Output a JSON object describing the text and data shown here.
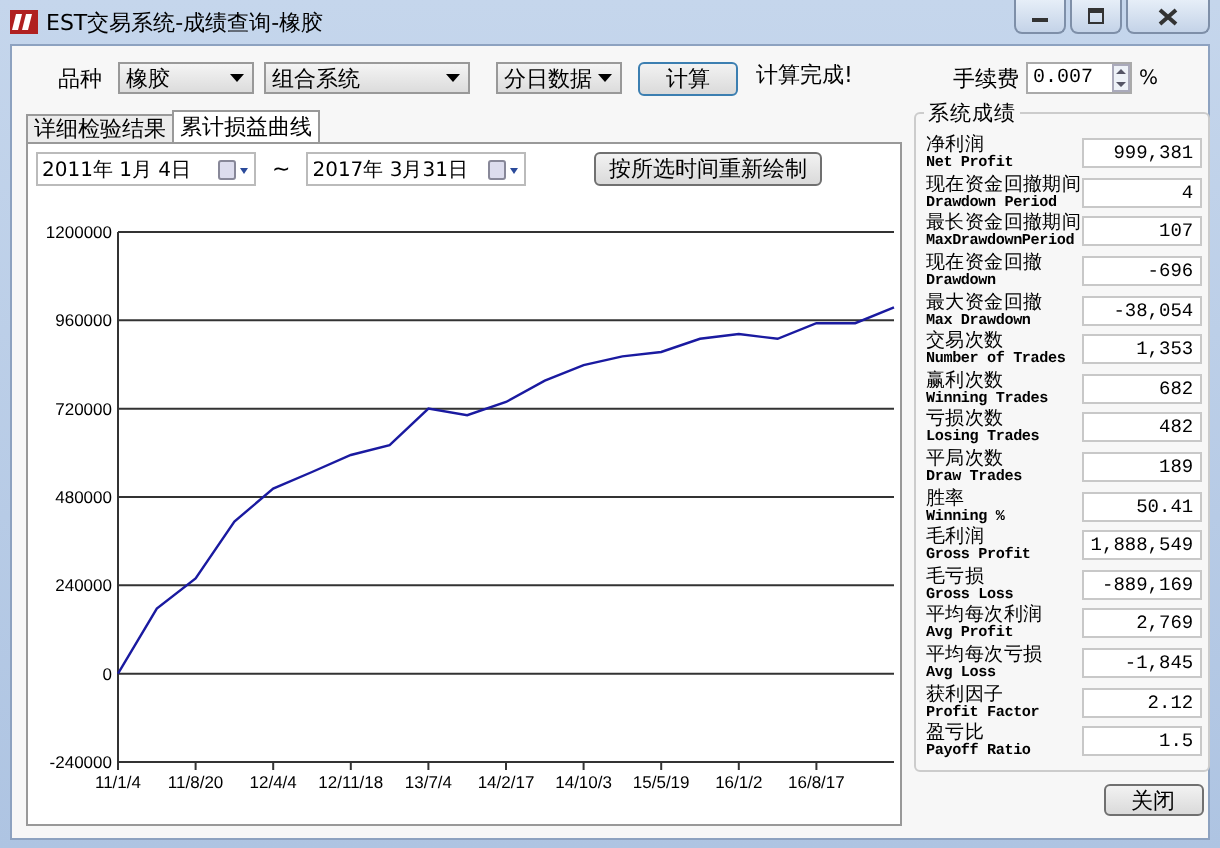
{
  "window": {
    "title": "EST交易系统-成绩查询-橡胶"
  },
  "toolbar": {
    "variety_label": "品种",
    "variety": "橡胶",
    "system": "组合系统",
    "data_mode": "分日数据",
    "calc_button": "计算",
    "status": "计算完成!",
    "fee_label": "手续费",
    "fee": "0.007",
    "fee_unit": "%"
  },
  "tabs": [
    {
      "label": "详细检验结果",
      "selected": false
    },
    {
      "label": "累计损益曲线",
      "selected": true
    }
  ],
  "range": {
    "start": "2011年 1月 4日",
    "separator": "~",
    "end": "2017年 3月31日",
    "redraw_button": "按所选时间重新绘制"
  },
  "chart": {
    "chart_data": {
      "type": "line",
      "categories": [
        "11/1/4",
        null,
        "11/8/20",
        null,
        "12/4/4",
        null,
        "12/11/18",
        null,
        "13/7/4",
        null,
        "14/2/17",
        null,
        "14/10/3",
        null,
        "15/5/19",
        null,
        "16/1/2",
        null,
        "16/8/17",
        null,
        null
      ],
      "ylim": [
        -240000,
        1200000
      ],
      "grid": true,
      "yticks": [
        -240000,
        0,
        240000,
        480000,
        720000,
        960000,
        1200000
      ],
      "series": [
        {
          "color": "#1a1aa0",
          "values": [
            0,
            177000,
            259000,
            413000,
            503000,
            548000,
            594000,
            621000,
            720000,
            702000,
            738000,
            796000,
            838000,
            862000,
            874000,
            910000,
            923000,
            910000,
            952000,
            952000,
            995000
          ]
        }
      ]
    }
  },
  "stats": {
    "title": "系统成绩",
    "rows": [
      {
        "label": "净利润",
        "label_en": "Net Profit",
        "value": "999,381"
      },
      {
        "label": "现在资金回撤期间",
        "label_en": "Drawdown Period",
        "value": "4"
      },
      {
        "label": "最长资金回撤期间",
        "label_en": "MaxDrawdownPeriod",
        "value": "107"
      },
      {
        "label": "现在资金回撤",
        "label_en": "Drawdown",
        "value": "-696"
      },
      {
        "label": "最大资金回撤",
        "label_en": "Max Drawdown",
        "value": "-38,054"
      },
      {
        "label": "交易次数",
        "label_en": "Number of Trades",
        "value": "1,353"
      },
      {
        "label": "赢利次数",
        "label_en": "Winning Trades",
        "value": "682"
      },
      {
        "label": "亏损次数",
        "label_en": "Losing Trades",
        "value": "482"
      },
      {
        "label": "平局次数",
        "label_en": "Draw Trades",
        "value": "189"
      },
      {
        "label": "胜率",
        "label_en": "Winning %",
        "value": "50.41"
      },
      {
        "label": "毛利润",
        "label_en": "Gross Profit",
        "value": "1,888,549"
      },
      {
        "label": "毛亏损",
        "label_en": "Gross Loss",
        "value": "-889,169"
      },
      {
        "label": "平均每次利润",
        "label_en": "Avg Profit",
        "value": "2,769"
      },
      {
        "label": "平均每次亏损",
        "label_en": "Avg Loss",
        "value": "-1,845"
      },
      {
        "label": "获利因子",
        "label_en": "Profit Factor",
        "value": "2.12"
      },
      {
        "label": "盈亏比",
        "label_en": "Payoff Ratio",
        "value": "1.5"
      }
    ]
  },
  "close_button": "关闭"
}
